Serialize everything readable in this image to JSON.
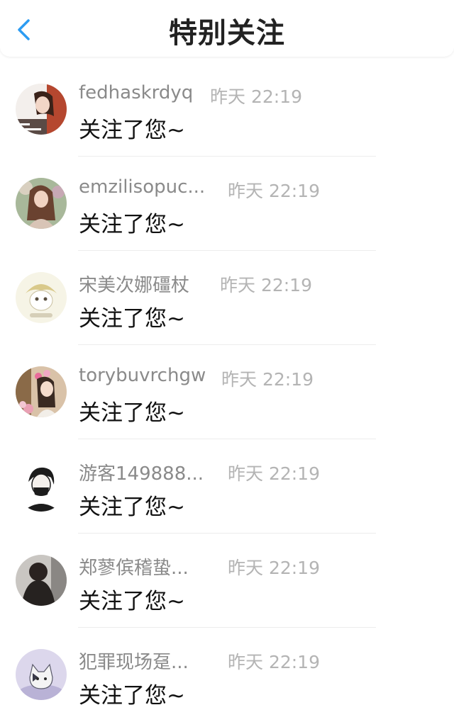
{
  "colors": {
    "accent": "#2c9cf2",
    "title": "#222222",
    "name": "#8a8a8a",
    "time": "#b4b4b4",
    "message": "#111111",
    "divider": "#ececec"
  },
  "header": {
    "title": "特别关注",
    "back_icon": "chevron-left-icon"
  },
  "rows": [
    {
      "name": "fedhaskrdyq",
      "time": "昨天 22:19",
      "message": "关注了您~",
      "avatar": "girl-photo-avatar"
    },
    {
      "name": "emzilisopuc...",
      "time": "昨天 22:19",
      "message": "关注了您~",
      "avatar": "woman-portrait-avatar"
    },
    {
      "name": "宋美次娜礓杖",
      "time": "昨天 22:19",
      "message": "关注了您~",
      "avatar": "cartoon-avatar"
    },
    {
      "name": "torybuvrchgw",
      "time": "昨天 22:19",
      "message": "关注了您~",
      "avatar": "girl-flowers-avatar"
    },
    {
      "name": "游客149888...",
      "time": "昨天 22:19",
      "message": "关注了您~",
      "avatar": "masked-boy-avatar"
    },
    {
      "name": "郑蓼傧稽蛰...",
      "time": "昨天 22:19",
      "message": "关注了您~",
      "avatar": "person-back-avatar"
    },
    {
      "name": "犯罪现场趸...",
      "time": "昨天 22:19",
      "message": "关注了您~",
      "avatar": "cat-illustration-avatar"
    }
  ]
}
